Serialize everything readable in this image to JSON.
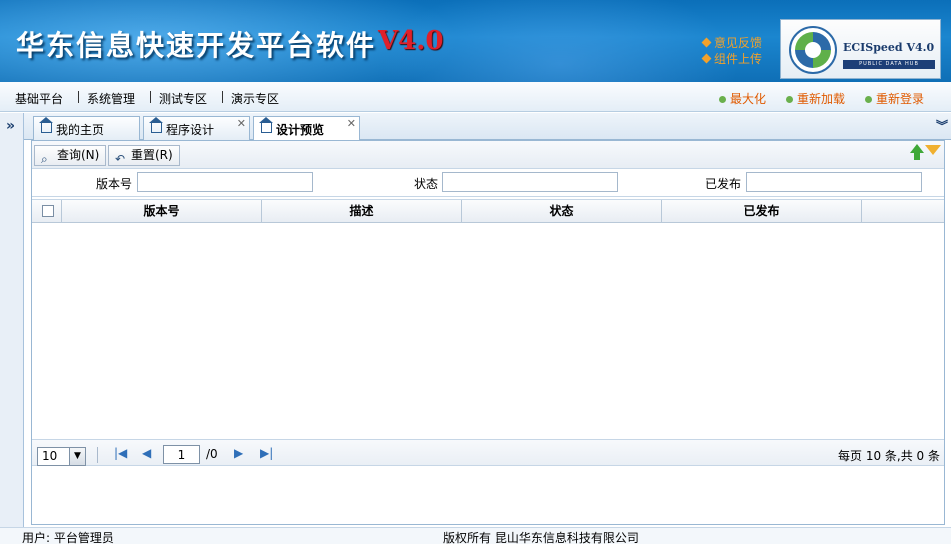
{
  "header": {
    "title": "华东信息快速开发平台软件",
    "version": "V4.0",
    "links": [
      "意见反馈",
      "组件上传"
    ],
    "logo": {
      "text": "ECISpeed V4.0",
      "tagline": "PUBLIC DATA HUB"
    }
  },
  "menubar": {
    "items": [
      "基础平台",
      "系统管理",
      "测试专区",
      "演示专区"
    ],
    "actions": [
      "最大化",
      "重新加载",
      "重新登录"
    ]
  },
  "tabs": [
    {
      "label": "我的主页",
      "closable": false,
      "active": false
    },
    {
      "label": "程序设计",
      "closable": true,
      "active": false
    },
    {
      "label": "设计预览",
      "closable": true,
      "active": true
    }
  ],
  "toolbar": {
    "query": "查询(N)",
    "reset": "重置(R)"
  },
  "filters": [
    {
      "label": "版本号",
      "value": ""
    },
    {
      "label": "状态",
      "value": ""
    },
    {
      "label": "已发布",
      "value": ""
    }
  ],
  "grid": {
    "columns": [
      "版本号",
      "描述",
      "状态",
      "已发布"
    ],
    "rows": []
  },
  "pager": {
    "page_size": "10",
    "current_page": "1",
    "total_pages": "/0",
    "info": "每页 10 条,共 0 条"
  },
  "status": {
    "user": "用户: 平台管理员",
    "copyright": "版权所有 昆山华东信息科技有限公司"
  },
  "colors": {
    "banner": "#1b86cf",
    "accent": "#e05a00",
    "version": "#e0202a"
  },
  "icons": [
    "home-icon",
    "close-icon",
    "search-icon",
    "undo-icon",
    "arrow-up-icon",
    "filter-icon",
    "first-page-icon",
    "prev-page-icon",
    "next-page-icon",
    "last-page-icon"
  ]
}
